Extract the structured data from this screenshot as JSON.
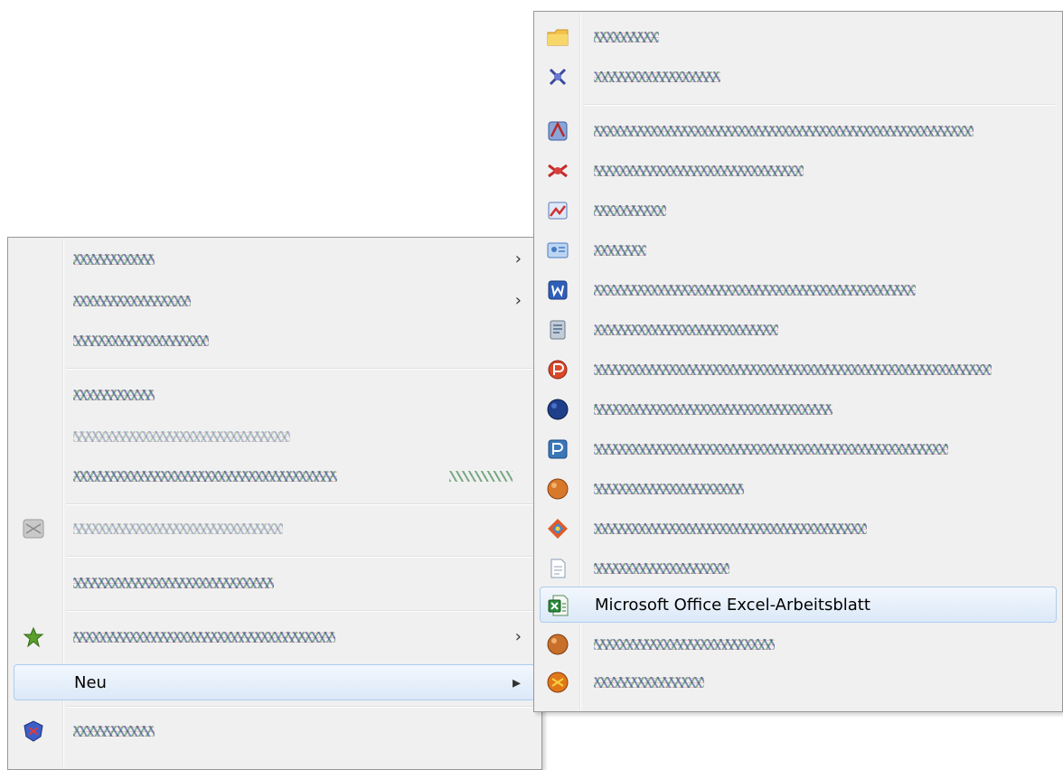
{
  "context_menu": {
    "items": [
      {
        "label": "",
        "has_submenu": true,
        "icon": null,
        "obscured": true,
        "disabled": false
      },
      {
        "label": "",
        "has_submenu": true,
        "icon": null,
        "obscured": true,
        "disabled": false
      },
      {
        "label": "",
        "has_submenu": false,
        "icon": null,
        "obscured": true,
        "disabled": false
      },
      {
        "label": "",
        "has_submenu": false,
        "icon": null,
        "obscured": true,
        "disabled": false
      },
      {
        "label": "",
        "has_submenu": false,
        "icon": null,
        "obscured": true,
        "disabled": true
      },
      {
        "label": "",
        "has_submenu": false,
        "icon": null,
        "obscured": true,
        "disabled": false,
        "shortcut": ""
      },
      {
        "label": "",
        "has_submenu": false,
        "icon": "grey-app-icon",
        "obscured": true,
        "disabled": true
      },
      {
        "label": "",
        "has_submenu": false,
        "icon": null,
        "obscured": true,
        "disabled": false
      },
      {
        "label": "",
        "has_submenu": true,
        "icon": "green-star-icon",
        "obscured": true,
        "disabled": false
      },
      {
        "label": "Neu",
        "has_submenu": true,
        "icon": null,
        "obscured": false,
        "highlighted": true
      },
      {
        "label": "",
        "has_submenu": false,
        "icon": "shield-app-icon",
        "obscured": true,
        "disabled": false
      }
    ],
    "submenu_arrow": "›",
    "highlighted_arrow": "▸"
  },
  "new_submenu": {
    "items": [
      {
        "label": "",
        "icon": "folder-icon",
        "obscured": true
      },
      {
        "label": "",
        "icon": "shortcut-icon",
        "obscured": true
      },
      {
        "label": "",
        "icon": "access-db-icon",
        "obscured": true
      },
      {
        "label": "",
        "icon": "red-app-icon",
        "obscured": true
      },
      {
        "label": "",
        "icon": "bitmap-icon",
        "obscured": true
      },
      {
        "label": "",
        "icon": "contact-icon",
        "obscured": true
      },
      {
        "label": "",
        "icon": "word-doc-icon",
        "obscured": true
      },
      {
        "label": "",
        "icon": "journal-icon",
        "obscured": true
      },
      {
        "label": "",
        "icon": "powerpoint-icon",
        "obscured": true
      },
      {
        "label": "",
        "icon": "blue-ball-icon",
        "obscured": true
      },
      {
        "label": "",
        "icon": "publisher-icon",
        "obscured": true
      },
      {
        "label": "",
        "icon": "orange-ball-icon",
        "obscured": true
      },
      {
        "label": "",
        "icon": "multicolor-app-icon",
        "obscured": true
      },
      {
        "label": "",
        "icon": "text-doc-icon",
        "obscured": true
      },
      {
        "label": "Microsoft Office Excel-Arbeitsblatt",
        "icon": "excel-icon",
        "obscured": false,
        "highlighted": true
      },
      {
        "label": "",
        "icon": "orange-ball-icon",
        "obscured": true
      },
      {
        "label": "",
        "icon": "zip-icon",
        "obscured": true
      }
    ]
  },
  "colors": {
    "menu_bg": "#f0f0f0",
    "menu_border": "#979797",
    "highlight_border": "#aeccef",
    "highlight_bg": "#dce9f8"
  }
}
